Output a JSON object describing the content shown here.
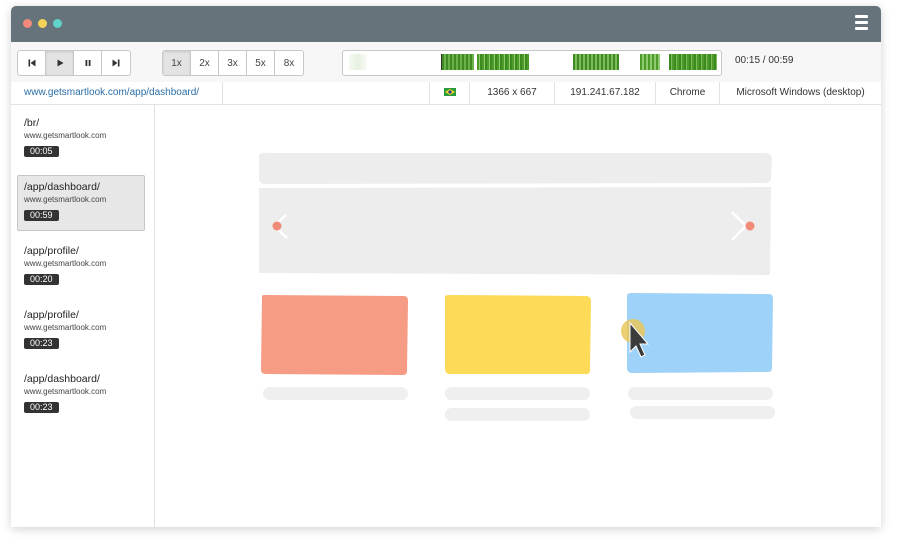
{
  "title_bar": {
    "dots": [
      {
        "name": "close",
        "color": "#ef8a7b"
      },
      {
        "name": "minimize",
        "color": "#f5d35b"
      },
      {
        "name": "maximize",
        "color": "#5fd3c9"
      }
    ],
    "menu_icon": "hamburger-menu-icon"
  },
  "player": {
    "controls": [
      {
        "name": "skip-back-button",
        "icon": "skip-back-icon"
      },
      {
        "name": "play-button",
        "icon": "play-icon",
        "active": true
      },
      {
        "name": "pause-button",
        "icon": "pause-icon"
      },
      {
        "name": "skip-forward-button",
        "icon": "skip-forward-icon"
      }
    ],
    "speeds": [
      "1x",
      "2x",
      "3x",
      "5x",
      "8x"
    ],
    "selected_speed": "1x",
    "time": "00:15 / 00:59",
    "activity_color": "#4e9a2a"
  },
  "session_info": {
    "url": "www.getsmartlook.com/app/dashboard/",
    "flag_icon": "brazil-flag-icon",
    "resolution": "1366 x 667",
    "ip": "191.241.67.182",
    "browser": "Chrome",
    "os": "Microsoft Windows (desktop)"
  },
  "pages": [
    {
      "path": "/br/",
      "host": "www.getsmartlook.com",
      "duration": "00:05",
      "active": false
    },
    {
      "path": "/app/dashboard/",
      "host": "www.getsmartlook.com",
      "duration": "00:59",
      "active": true
    },
    {
      "path": "/app/profile/",
      "host": "www.getsmartlook.com",
      "duration": "00:20",
      "active": false
    },
    {
      "path": "/app/profile/",
      "host": "www.getsmartlook.com",
      "duration": "00:23",
      "active": false
    },
    {
      "path": "/app/dashboard/",
      "host": "www.getsmartlook.com",
      "duration": "00:23",
      "active": false
    }
  ],
  "preview": {
    "card_colors": [
      "#f69c85",
      "#fdda57",
      "#9fd2f8"
    ],
    "slider_dot_color": "#f08b78",
    "click_highlight_color": "#e9c85a",
    "cursor_icon": "mouse-cursor-icon"
  }
}
